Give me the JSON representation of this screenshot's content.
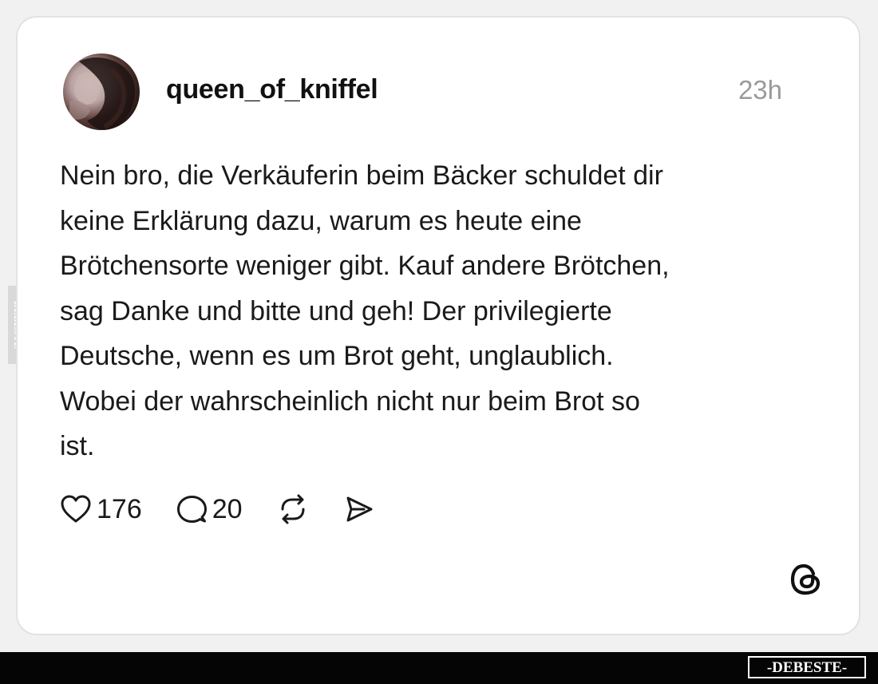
{
  "post": {
    "username": "queen_of_kniffel",
    "timestamp": "23h",
    "text": "Nein bro, die Verkäuferin beim Bäcker schuldet dir\nkeine Erklärung dazu, warum es heute eine\nBrötchensorte weniger gibt. Kauf andere Brötchen,\nsag Danke und bitte und geh! Der privilegierte\nDeutsche, wenn es um Brot geht, unglaublich.\nWobei der wahrscheinlich nicht nur beim Brot so\nist.",
    "avatar_icon": "profile-photo",
    "actions": {
      "like": {
        "icon": "heart-icon",
        "count": "176"
      },
      "comment": {
        "icon": "comment-bubble-icon",
        "count": "20"
      },
      "repost": {
        "icon": "repost-icon"
      },
      "share": {
        "icon": "send-icon"
      }
    }
  },
  "branding": {
    "platform_logo": "threads-logo",
    "watermark": "-DEBESTE-",
    "side_watermark": "DEBESTE"
  },
  "colors": {
    "card_background": "#ffffff",
    "text": "#1a1a1a",
    "timestamp": "#9a9a9a",
    "bottom_bar": "#050505"
  }
}
